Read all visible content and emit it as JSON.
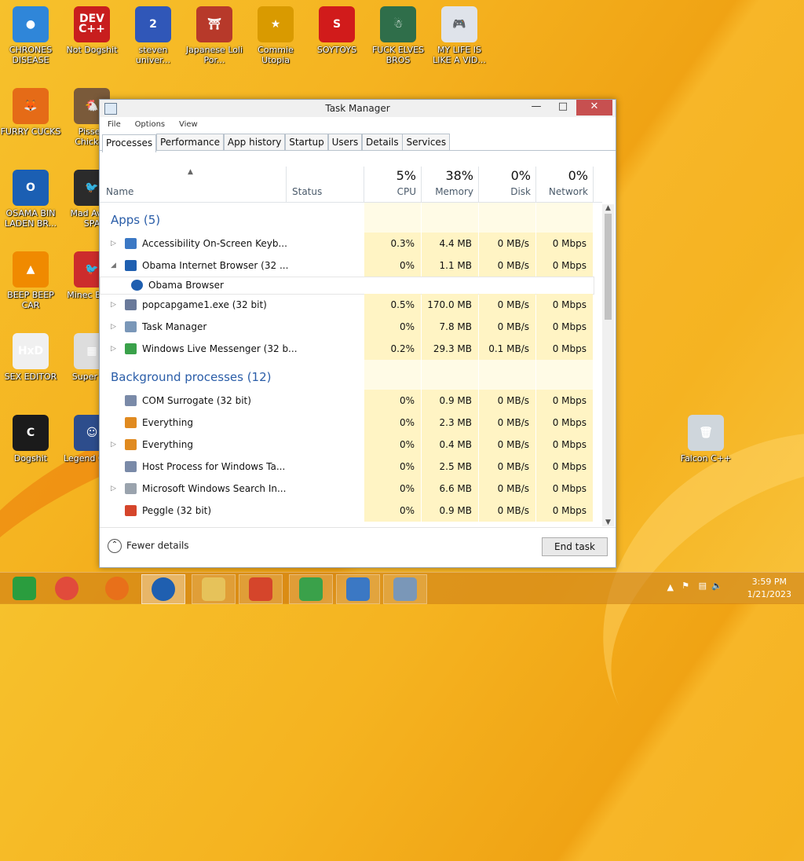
{
  "desktop": {
    "icons": [
      {
        "label": "CHRONES DISEASE",
        "color": "#2f86d9",
        "glyph": "●"
      },
      {
        "label": "Not Dogshit",
        "color": "#c81e1e",
        "glyph": "DEV C++"
      },
      {
        "label": "steven univer...",
        "color": "#3057b8",
        "glyph": "2"
      },
      {
        "label": "Japanese Loli Por...",
        "color": "#b7392a",
        "glyph": "⛩"
      },
      {
        "label": "Commie Utopia",
        "color": "#d99a00",
        "glyph": "★"
      },
      {
        "label": "SOYTOYS",
        "color": "#d11b1b",
        "glyph": "S"
      },
      {
        "label": "FUCK ELVES BROS",
        "color": "#2f6e4a",
        "glyph": "☃"
      },
      {
        "label": "MY LIFE IS LIKE A VID...",
        "color": "#dfe3ea",
        "glyph": "🎮"
      },
      {
        "label": "FURRY CUCKS",
        "color": "#e56b17",
        "glyph": "🦊"
      },
      {
        "label": "Pissed Chicken",
        "color": "#7a5a3a",
        "glyph": "🐔"
      },
      {
        "label": "OSAMA BIN LADEN BR...",
        "color": "#1b5fb3",
        "glyph": "O"
      },
      {
        "label": "Mad Av IN SPA",
        "color": "#2b2b2b",
        "glyph": "🐦"
      },
      {
        "label": "BEEP BEEP CAR",
        "color": "#f08a00",
        "glyph": "▲"
      },
      {
        "label": "Minec Birds",
        "color": "#cc2c2c",
        "glyph": "🐦"
      },
      {
        "label": "SEX EDITOR",
        "color": "#f0f0f0",
        "glyph": "HxD"
      },
      {
        "label": "Super Ch",
        "color": "#dddddd",
        "glyph": "▦"
      },
      {
        "label": "Dogshit",
        "color": "#1b1b1b",
        "glyph": "C"
      },
      {
        "label": "Legend CRYA",
        "color": "#2d4d8c",
        "glyph": "☺"
      },
      {
        "label": "Falcon C++",
        "color": "#cfd6dc",
        "glyph": "🗑"
      }
    ]
  },
  "window": {
    "title": "Task Manager",
    "menu": [
      "File",
      "Options",
      "View"
    ],
    "tabs": [
      "Processes",
      "Performance",
      "App history",
      "Startup",
      "Users",
      "Details",
      "Services"
    ],
    "active_tab": "Processes"
  },
  "columns": {
    "name": "Name",
    "status": "Status",
    "cpu": {
      "pct": "5%",
      "label": "CPU"
    },
    "memory": {
      "pct": "38%",
      "label": "Memory"
    },
    "disk": {
      "pct": "0%",
      "label": "Disk"
    },
    "network": {
      "pct": "0%",
      "label": "Network"
    }
  },
  "groups": [
    {
      "label": "Apps (5)",
      "rows": [
        {
          "name": "Accessibility On-Screen Keyb...",
          "cpu": "0.3%",
          "mem": "4.4 MB",
          "disk": "0 MB/s",
          "net": "0 Mbps",
          "exp": "▷",
          "color": "#3b78c4"
        },
        {
          "name": "Obama Internet Browser (32 ...",
          "cpu": "0%",
          "mem": "1.1 MB",
          "disk": "0 MB/s",
          "net": "0 Mbps",
          "exp": "◢",
          "color": "#1f5fb0"
        },
        {
          "name": "Obama Browser",
          "child": true,
          "color": "#1f5fb0"
        },
        {
          "name": "popcapgame1.exe (32 bit)",
          "cpu": "0.5%",
          "mem": "170.0 MB",
          "disk": "0 MB/s",
          "net": "0 Mbps",
          "exp": "▷",
          "color": "#6a7a9a"
        },
        {
          "name": "Task Manager",
          "cpu": "0%",
          "mem": "7.8 MB",
          "disk": "0 MB/s",
          "net": "0 Mbps",
          "exp": "▷",
          "color": "#7a97b8"
        },
        {
          "name": "Windows Live Messenger (32 b...",
          "cpu": "0.2%",
          "mem": "29.3 MB",
          "disk": "0.1 MB/s",
          "net": "0 Mbps",
          "exp": "▷",
          "color": "#3aa14a"
        }
      ]
    },
    {
      "label": "Background processes (12)",
      "rows": [
        {
          "name": "COM Surrogate (32 bit)",
          "cpu": "0%",
          "mem": "0.9 MB",
          "disk": "0 MB/s",
          "net": "0 Mbps",
          "exp": "",
          "color": "#7a8aa8"
        },
        {
          "name": "Everything",
          "cpu": "0%",
          "mem": "2.3 MB",
          "disk": "0 MB/s",
          "net": "0 Mbps",
          "exp": "",
          "color": "#e08a20"
        },
        {
          "name": "Everything",
          "cpu": "0%",
          "mem": "0.4 MB",
          "disk": "0 MB/s",
          "net": "0 Mbps",
          "exp": "▷",
          "color": "#e08a20"
        },
        {
          "name": "Host Process for Windows Ta...",
          "cpu": "0%",
          "mem": "2.5 MB",
          "disk": "0 MB/s",
          "net": "0 Mbps",
          "exp": "",
          "color": "#7a8aa8"
        },
        {
          "name": "Microsoft Windows Search In...",
          "cpu": "0%",
          "mem": "6.6 MB",
          "disk": "0 MB/s",
          "net": "0 Mbps",
          "exp": "▷",
          "color": "#9aa3ad"
        },
        {
          "name": "Peggle (32 bit)",
          "cpu": "0%",
          "mem": "0.9 MB",
          "disk": "0 MB/s",
          "net": "0 Mbps",
          "exp": "",
          "color": "#d5452b"
        }
      ]
    }
  ],
  "footer": {
    "fewer_details": "Fewer details",
    "end_task": "End task"
  },
  "taskbar": {
    "items": [
      {
        "name": "desktop-start",
        "color": "#2a9d3e"
      },
      {
        "name": "chrome",
        "color": "#e14b3b"
      },
      {
        "name": "firefox",
        "color": "#e8701a"
      },
      {
        "name": "obama-browser",
        "color": "#1f5fb0"
      },
      {
        "name": "file-explorer",
        "color": "#e6c25a"
      },
      {
        "name": "popcap",
        "color": "#d5452b"
      },
      {
        "name": "messenger",
        "color": "#3aa14a"
      },
      {
        "name": "on-screen-keyboard",
        "color": "#3b78c4"
      },
      {
        "name": "task-manager",
        "color": "#7a97b8"
      }
    ],
    "time": "3:59 PM",
    "date": "1/21/2023"
  }
}
